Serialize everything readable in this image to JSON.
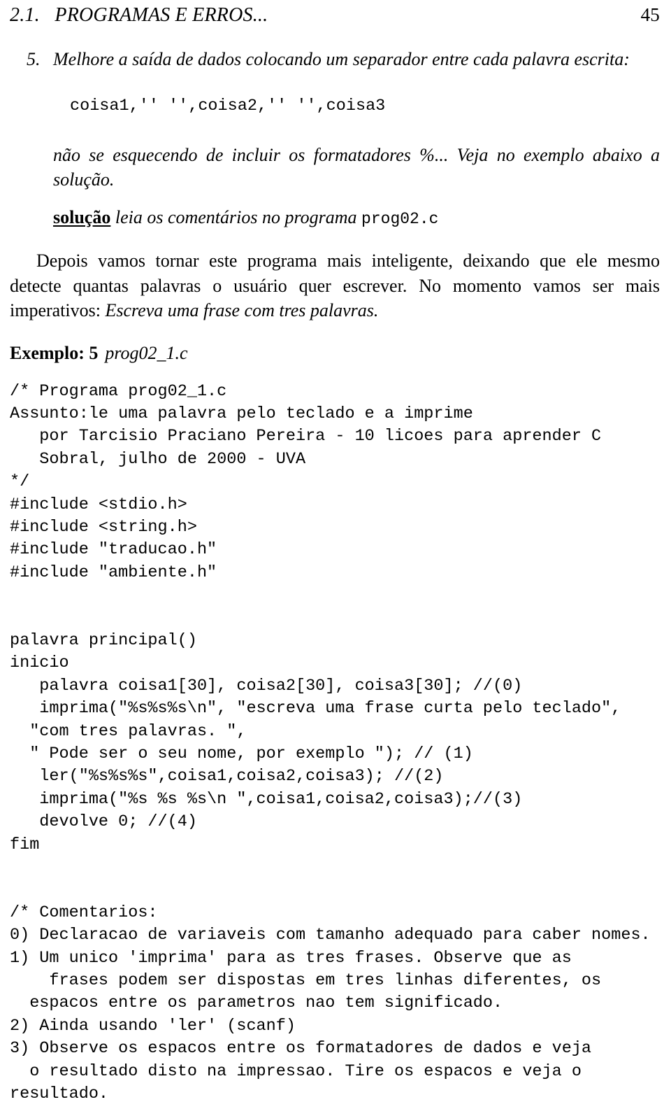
{
  "header": {
    "left": "2.1.   PROGRAMAS E ERROS...",
    "page_number": "45"
  },
  "exercise": {
    "marker": "5.",
    "text_part1": "Melhore a saída de dados ",
    "text_part2": "colocando um separador entre cada palavra escrita:",
    "snippet": "coisa1,'' '',coisa2,'' '',coisa3",
    "tail": "não se esquecendo de incluir os formatadores %... Veja no exemplo abaixo a solução."
  },
  "solucao": {
    "label": "solução",
    "middle": " leia os comentários no programa ",
    "file": "prog02.c"
  },
  "paragraph": {
    "plain1": "Depois vamos tornar este programa mais inteligente, deixando que ele mesmo detecte quantas palavras o usuário quer escrever. No momento vamos ser mais imperativos: ",
    "italic1": "Escreva uma frase com tres palavras."
  },
  "exemplo": {
    "label": "Exemplo: 5",
    "filename": "prog02_1.c"
  },
  "code": {
    "lines": [
      "/* Programa prog02_1.c",
      "Assunto:le uma palavra pelo teclado e a imprime",
      "   por Tarcisio Praciano Pereira - 10 licoes para aprender C",
      "   Sobral, julho de 2000 - UVA",
      "*/",
      "#include <stdio.h>",
      "#include <string.h>",
      "#include \"traducao.h\"",
      "#include \"ambiente.h\"",
      "",
      "",
      "palavra principal()",
      "inicio",
      "   palavra coisa1[30], coisa2[30], coisa3[30]; //(0)",
      "   imprima(\"%s%s%s\\n\", \"escreva uma frase curta pelo teclado\",",
      "  \"com tres palavras. \",",
      "  \" Pode ser o seu nome, por exemplo \"); // (1)",
      "   ler(\"%s%s%s\",coisa1,coisa2,coisa3); //(2)",
      "   imprima(\"%s %s %s\\n \",coisa1,coisa2,coisa3);//(3)",
      "   devolve 0; //(4)",
      "fim",
      "",
      "",
      "/* Comentarios:",
      "0) Declaracao de variaveis com tamanho adequado para caber nomes.",
      "1) Um unico 'imprima' para as tres frases. Observe que as",
      "    frases podem ser dispostas em tres linhas diferentes, os",
      "  espacos entre os parametros nao tem significado.",
      "2) Ainda usando 'ler' (scanf)",
      "3) Observe os espacos entre os formatadores de dados e veja",
      "  o resultado disto na impressao. Tire os espacos e veja o",
      "resultado."
    ]
  }
}
